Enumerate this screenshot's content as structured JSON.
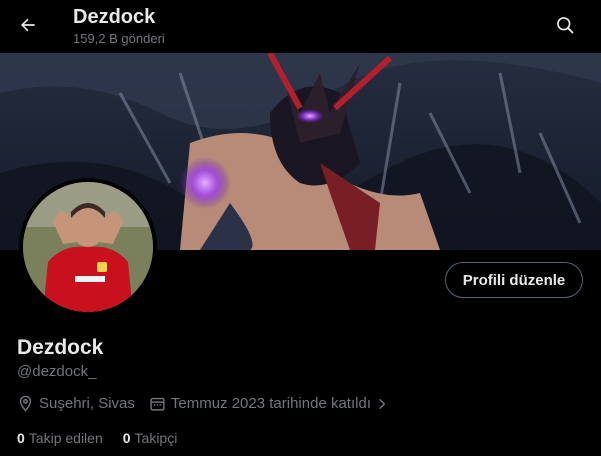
{
  "header": {
    "title": "Dezdock",
    "subtitle": "159,2 B gönderi"
  },
  "icons": {
    "back": "back-arrow-icon",
    "search": "search-icon",
    "location": "location-pin-icon",
    "calendar": "calendar-icon",
    "chevron": "chevron-right-icon"
  },
  "profile": {
    "display_name": "Dezdock",
    "handle": "@dezdock_",
    "edit_button": "Profili düzenle",
    "location": "Suşehri, Sivas",
    "joined": "Temmuz 2023 tarihinde katıldı",
    "following_count": "0",
    "following_label": "Takip edilen",
    "followers_count": "0",
    "followers_label": "Takipçi"
  },
  "colors": {
    "background": "#000000",
    "primary_text": "#e7e9ea",
    "secondary_text": "#71767b",
    "button_border": "#536471"
  }
}
